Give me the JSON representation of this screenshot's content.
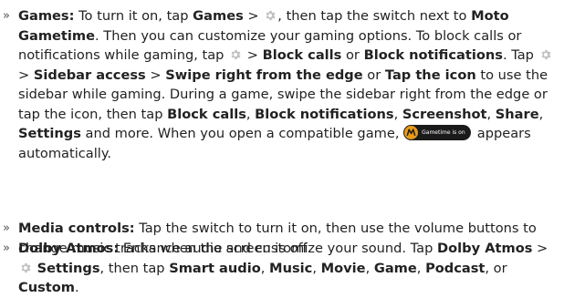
{
  "bullet_glyph": "»",
  "colors": {
    "text": "#222222",
    "gear_icon": "#c2c2c2",
    "moto_badge": "#e99a1b",
    "pill_bg": "#1a1a1a"
  },
  "games": {
    "label": "Games:",
    "t1": " To turn it on, tap ",
    "b_games": "Games",
    "t2": " > ",
    "t3": ", then tap the switch next to ",
    "b_moto_gametime": "Moto Gametime",
    "t4": ". Then you can customize your gaming options. To block calls or notifications while gaming, tap ",
    "t5": " > ",
    "b_block_calls": "Block calls",
    "t6": " or ",
    "b_block_notifications": "Block notifications",
    "t7": ". Tap ",
    "t8": " > ",
    "b_sidebar_access": "Sidebar access",
    "t9": " > ",
    "b_swipe_right": "Swipe right from the edge",
    "t10": " or ",
    "b_tap_icon": "Tap the icon",
    "t11": " to use the sidebar while gaming. During a game, swipe the sidebar right from the edge or tap the icon, then tap ",
    "b_block_calls_2": "Block calls",
    "t12": ", ",
    "b_block_notifications_2": "Block notifications",
    "t13": ", ",
    "b_screenshot": "Screenshot",
    "t14": ", ",
    "b_share": "Share",
    "t15": ", ",
    "b_settings": "Settings",
    "t16": " and more. When you open a compatible game, ",
    "pill_text": "Gametime is on",
    "t17": " appears automatically."
  },
  "media": {
    "label": "Media controls:",
    "t1": " Tap the switch to turn it on, then use the volume buttons to change music tracks when the screen is off."
  },
  "dolby": {
    "label": "Dolby Atmos:",
    "t1": " Enhance audio and customize your sound. Tap ",
    "b_dolby_atmos": "Dolby Atmos",
    "t2": " > ",
    "b_settings": "Settings",
    "t3": ", then tap ",
    "b_smart_audio": "Smart audio",
    "t4": ", ",
    "b_music": "Music",
    "t5": ", ",
    "b_movie": "Movie",
    "t6": ", ",
    "b_game": "Game",
    "t7": ", ",
    "b_podcast": "Podcast",
    "t8": ", or ",
    "b_custom": "Custom",
    "t9": "."
  }
}
